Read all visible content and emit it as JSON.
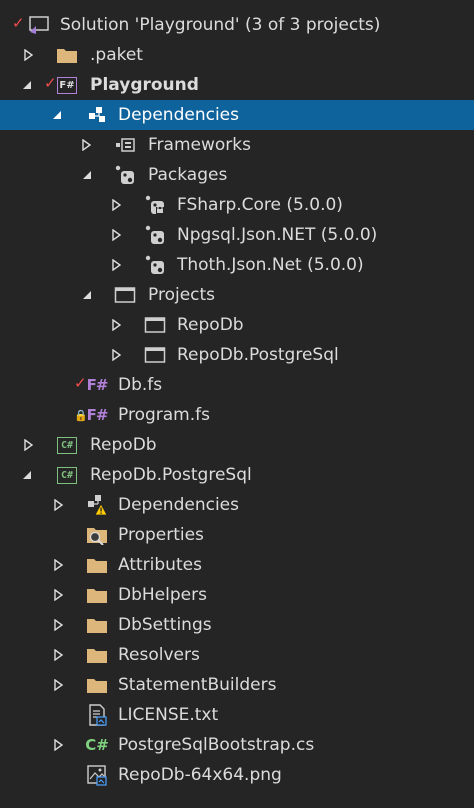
{
  "tree": {
    "solution": {
      "label": "Solution 'Playground' (3 of 3 projects)"
    },
    "paket": {
      "label": ".paket"
    },
    "playground": {
      "label": "Playground"
    },
    "dependencies": {
      "label": "Dependencies"
    },
    "frameworks": {
      "label": "Frameworks"
    },
    "packages": {
      "label": "Packages"
    },
    "fsharp_core": {
      "label": "FSharp.Core (5.0.0)"
    },
    "npgsql": {
      "label": "Npgsql.Json.NET (5.0.0)"
    },
    "thoth": {
      "label": "Thoth.Json.Net (5.0.0)"
    },
    "projects": {
      "label": "Projects"
    },
    "proj_repodb": {
      "label": "RepoDb"
    },
    "proj_repodb_pg": {
      "label": "RepoDb.PostgreSql"
    },
    "db_fs": {
      "label": "Db.fs"
    },
    "program_fs": {
      "label": "Program.fs"
    },
    "repodb": {
      "label": "RepoDb"
    },
    "repodb_pg": {
      "label": "RepoDb.PostgreSql"
    },
    "pg_dependencies": {
      "label": "Dependencies"
    },
    "properties": {
      "label": "Properties"
    },
    "attributes": {
      "label": "Attributes"
    },
    "dbhelpers": {
      "label": "DbHelpers"
    },
    "dbsettings": {
      "label": "DbSettings"
    },
    "resolvers": {
      "label": "Resolvers"
    },
    "statementbuilders": {
      "label": "StatementBuilders"
    },
    "license": {
      "label": "LICENSE.txt"
    },
    "bootstrap": {
      "label": "PostgreSqlBootstrap.cs"
    },
    "png": {
      "label": "RepoDb-64x64.png"
    }
  },
  "icons": {
    "fsharp": "F#",
    "csharp": "C#"
  },
  "colors": {
    "background": "#252526",
    "selection": "#0e639c",
    "folder": "#dcb67a",
    "check": "#f14c4c"
  }
}
